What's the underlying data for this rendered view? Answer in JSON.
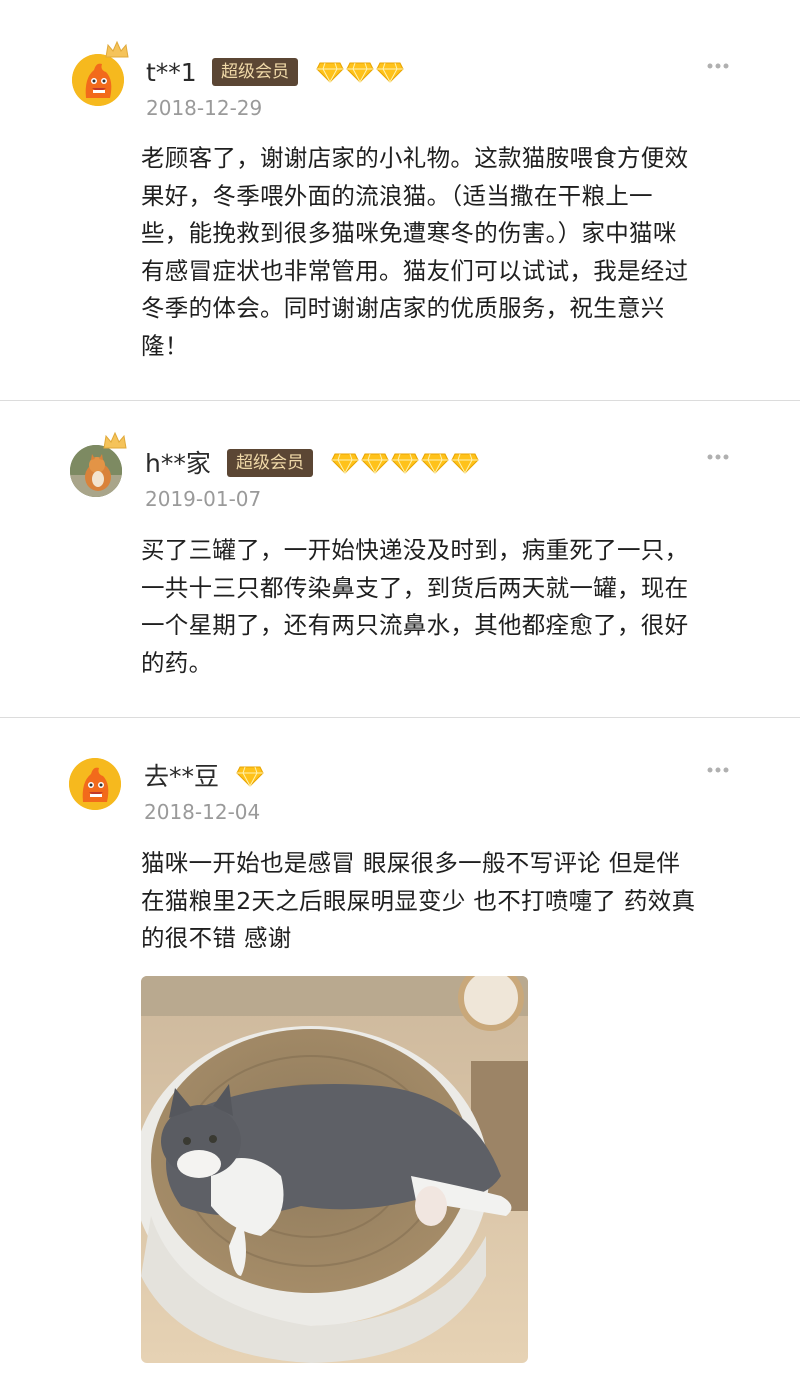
{
  "colors": {
    "badge_bg": "#5b4634",
    "badge_text": "#f0d9a8",
    "gem": "#ffc21a",
    "divider": "#dcdcdc",
    "date": "#9a9a9a"
  },
  "reviews": [
    {
      "username": "t**1",
      "badge": "超级会员",
      "gem_count": 3,
      "date": "2018-12-29",
      "text": "老顾客了，谢谢店家的小礼物。这款猫胺喂食方便效\n果好，冬季喂外面的流浪猫。（适当撒在干粮上一\n些，能挽救到很多猫咪免遭寒冬的伤害。）家中猫咪\n有感冒症状也非常管用。猫友们可以试试，我是经过\n冬季的体会。同时谢谢店家的优质服务，祝生意兴\n隆！",
      "avatar": "mascot-avatar"
    },
    {
      "username": "h**家",
      "badge": "超级会员",
      "gem_count": 5,
      "date": "2019-01-07",
      "text": "买了三罐了，一开始快递没及时到，病重死了一只，\n一共十三只都传染鼻支了，到货后两天就一罐，现在\n一个星期了，还有两只流鼻水，其他都痊愈了，很好\n的药。",
      "avatar": "cat-photo-avatar"
    },
    {
      "username": "去**豆",
      "gem_count": 1,
      "date": "2018-12-04",
      "text": "猫咪一开始也是感冒 眼屎很多一般不写评论 但是伴\n在猫粮里2天之后眼屎明显变少 也不打喷嚏了 药效真\n的很不错 感谢",
      "avatar": "mascot-avatar",
      "photo": "cat-in-scratcher-photo"
    }
  ]
}
